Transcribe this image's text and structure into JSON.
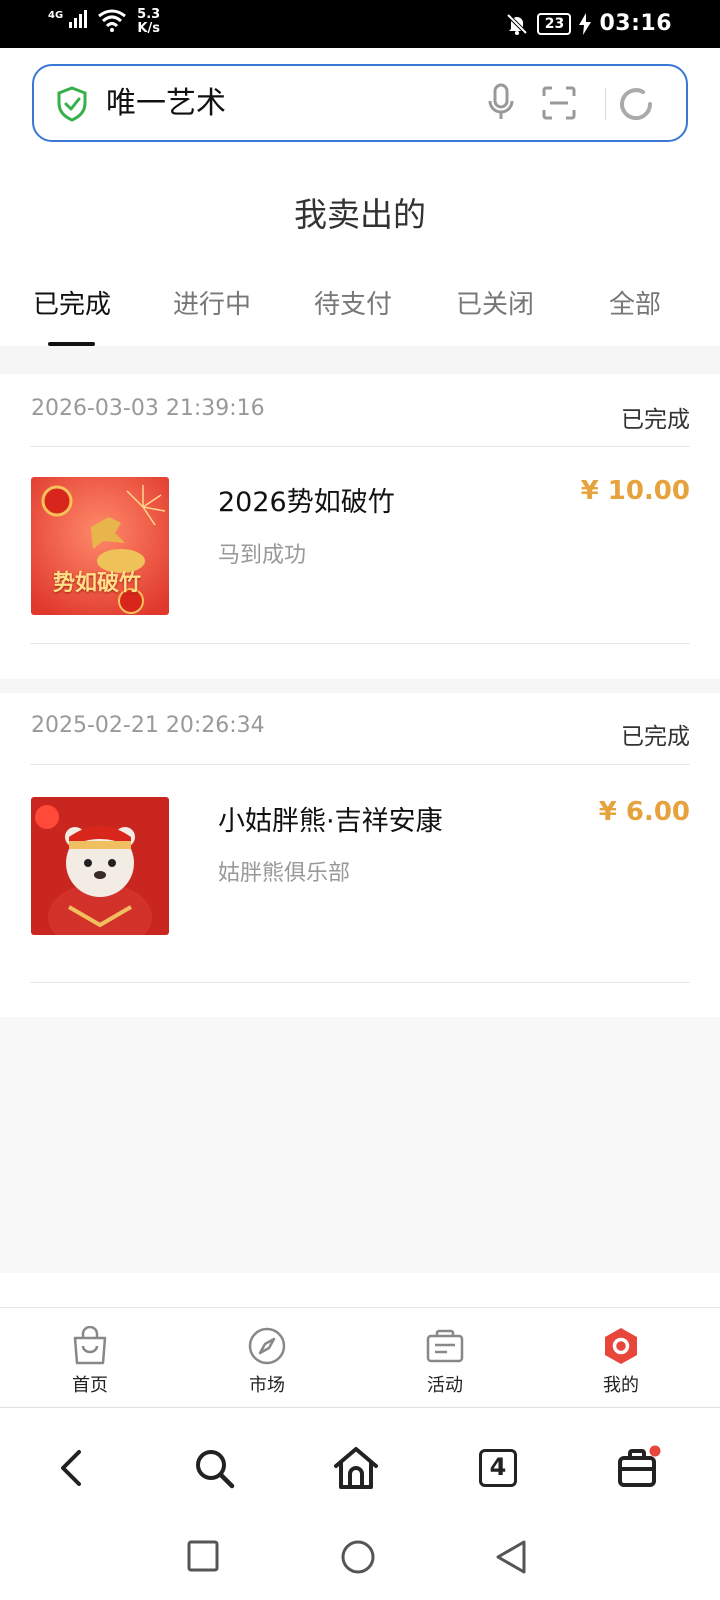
{
  "status_bar": {
    "network": "4G",
    "speed_value": "5.3",
    "speed_unit": "K/s",
    "battery": "23",
    "time": "03:16"
  },
  "address_bar": {
    "url_text": "唯一艺术"
  },
  "page": {
    "title": "我卖出的"
  },
  "tabs": [
    {
      "label": "已完成",
      "active": true
    },
    {
      "label": "进行中",
      "active": false
    },
    {
      "label": "待支付",
      "active": false
    },
    {
      "label": "已关闭",
      "active": false
    },
    {
      "label": "全部",
      "active": false
    }
  ],
  "orders": [
    {
      "time": "2026-03-03 21:39:16",
      "status": "已完成",
      "title": "2026势如破竹",
      "subtitle": "马到成功",
      "price": "¥ 10.00",
      "thumb_caption": "势如破竹"
    },
    {
      "time": "2025-02-21 20:26:34",
      "status": "已完成",
      "title": "小姑胖熊·吉祥安康",
      "subtitle": "姑胖熊俱乐部",
      "price": "¥ 6.00"
    }
  ],
  "bottom_nav": [
    {
      "label": "首页",
      "icon": "bag-icon"
    },
    {
      "label": "市场",
      "icon": "compass-icon"
    },
    {
      "label": "活动",
      "icon": "ticket-icon"
    },
    {
      "label": "我的",
      "icon": "profile-badge-icon"
    }
  ],
  "browser_toolbar": {
    "tab_count": "4"
  },
  "colors": {
    "accent_blue": "#3a78d6",
    "price": "#e6a23c",
    "active_nav": "#e8463a"
  }
}
